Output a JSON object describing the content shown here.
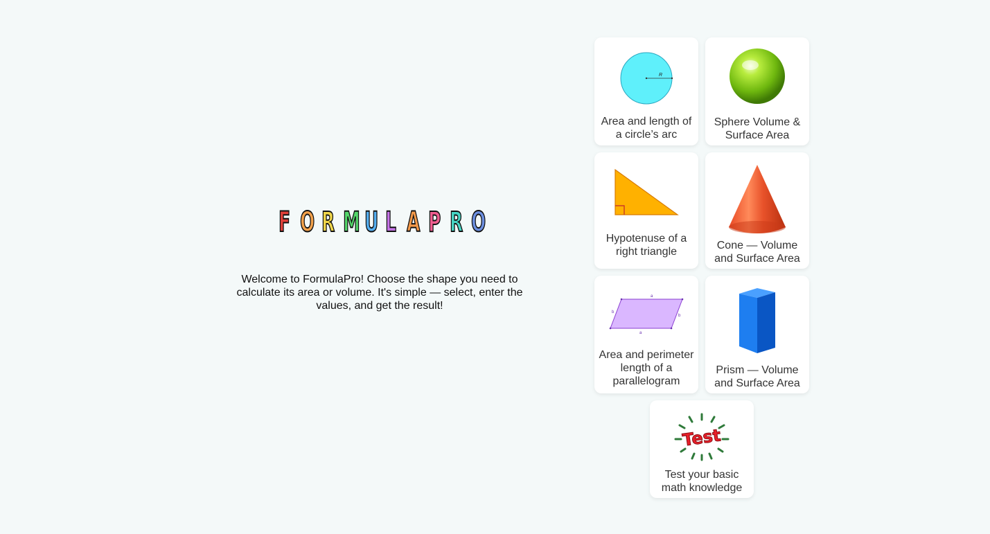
{
  "logo": {
    "letters": [
      {
        "char": "F",
        "color": "#e0403a"
      },
      {
        "char": "O",
        "color": "#f2a14b"
      },
      {
        "char": "R",
        "color": "#f0d64a"
      },
      {
        "char": "M",
        "color": "#54d66a"
      },
      {
        "char": "U",
        "color": "#54aef0"
      },
      {
        "char": "L",
        "color": "#c473e6"
      },
      {
        "char": "A",
        "color": "#f59a4a"
      },
      {
        "char": "P",
        "color": "#ef5d8f"
      },
      {
        "char": "R",
        "color": "#47d6c5"
      },
      {
        "char": "O",
        "color": "#6c8fe0"
      }
    ]
  },
  "welcome_text": "Welcome to FormulaPro! Choose the shape you need to calculate its area or volume. It's simple — select, enter the values, and get the result!",
  "cards": [
    {
      "id": "circle",
      "label": "Area and length of a circle’s arc",
      "icon": "circle-icon",
      "radius_label": "R"
    },
    {
      "id": "sphere",
      "label": "Sphere Volume & Surface Area",
      "icon": "sphere-icon"
    },
    {
      "id": "triangle",
      "label": "Hypotenuse of a right triangle",
      "icon": "right-triangle-icon"
    },
    {
      "id": "cone",
      "label": "Cone — Volume and Surface Area",
      "icon": "cone-icon"
    },
    {
      "id": "parallelogram",
      "label": "Area and perimeter length of a parallelogram",
      "icon": "parallelogram-icon",
      "side_a": "a",
      "side_b": "b"
    },
    {
      "id": "prism",
      "label": "Prism — Volume and Surface Area",
      "icon": "prism-icon"
    },
    {
      "id": "test",
      "label": "Test your basic math knowledge",
      "icon": "test-icon",
      "badge_text": "Test"
    }
  ]
}
